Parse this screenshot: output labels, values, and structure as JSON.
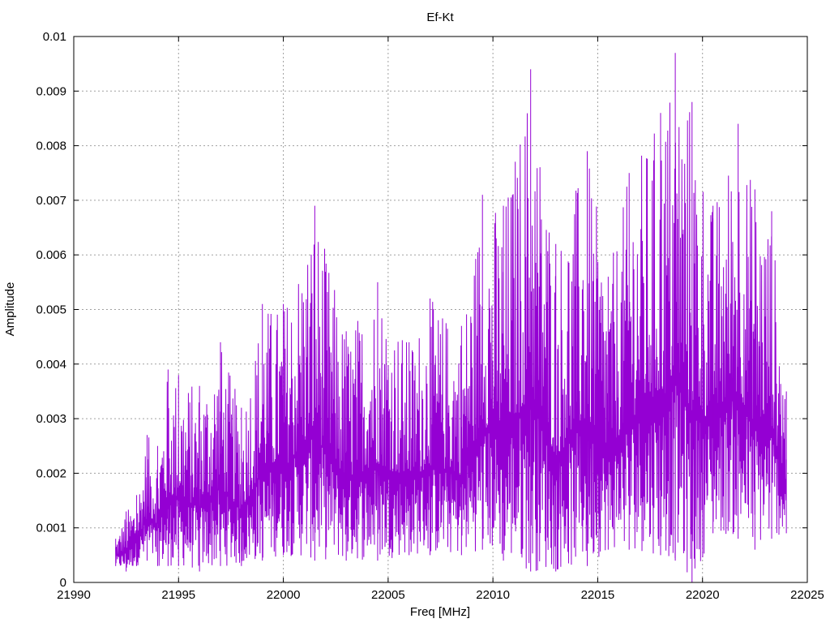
{
  "chart_data": {
    "type": "line",
    "title": "Ef-Kt",
    "xlabel": "Freq [MHz]",
    "ylabel": "Amplitude",
    "xlim": [
      21990,
      22025
    ],
    "ylim": [
      0,
      0.01
    ],
    "xticks": [
      "21990",
      "21995",
      "22000",
      "22005",
      "22010",
      "22015",
      "22020",
      "22025"
    ],
    "yticks": [
      "0",
      "0.001",
      "0.002",
      "0.003",
      "0.004",
      "0.005",
      "0.006",
      "0.007",
      "0.008",
      "0.009",
      "0.01"
    ],
    "grid": true,
    "legend": "none",
    "series": [
      {
        "color": "#9400d3",
        "x_start": 21992.0,
        "x_end": 22024.0,
        "envelope": [
          {
            "x": 21992.0,
            "low": 0.0003,
            "high": 0.0008
          },
          {
            "x": 21992.5,
            "low": 0.0002,
            "high": 0.0013
          },
          {
            "x": 21993.0,
            "low": 0.0003,
            "high": 0.0016
          },
          {
            "x": 21993.5,
            "low": 0.0004,
            "high": 0.0027
          },
          {
            "x": 21994.0,
            "low": 0.0003,
            "high": 0.0025
          },
          {
            "x": 21994.5,
            "low": 0.0003,
            "high": 0.0039
          },
          {
            "x": 21995.0,
            "low": 0.0003,
            "high": 0.0038
          },
          {
            "x": 21996.0,
            "low": 0.0002,
            "high": 0.0036
          },
          {
            "x": 21997.0,
            "low": 0.0003,
            "high": 0.0044
          },
          {
            "x": 21998.0,
            "low": 0.0003,
            "high": 0.0032
          },
          {
            "x": 21999.0,
            "low": 0.0004,
            "high": 0.0051
          },
          {
            "x": 22000.0,
            "low": 0.0005,
            "high": 0.0051
          },
          {
            "x": 22001.5,
            "low": 0.0004,
            "high": 0.0069
          },
          {
            "x": 22003.0,
            "low": 0.0004,
            "high": 0.0046
          },
          {
            "x": 22004.5,
            "low": 0.0004,
            "high": 0.0055
          },
          {
            "x": 22006.0,
            "low": 0.0005,
            "high": 0.0044
          },
          {
            "x": 22007.0,
            "low": 0.0005,
            "high": 0.0052
          },
          {
            "x": 22008.5,
            "low": 0.0005,
            "high": 0.0047
          },
          {
            "x": 22009.5,
            "low": 0.0006,
            "high": 0.0071
          },
          {
            "x": 22010.5,
            "low": 0.0004,
            "high": 0.0069
          },
          {
            "x": 22011.8,
            "low": 0.0002,
            "high": 0.0094
          },
          {
            "x": 22013.0,
            "low": 0.0002,
            "high": 0.0062
          },
          {
            "x": 22014.5,
            "low": 0.0003,
            "high": 0.0079
          },
          {
            "x": 22015.5,
            "low": 0.0006,
            "high": 0.0056
          },
          {
            "x": 22016.5,
            "low": 0.0006,
            "high": 0.0075
          },
          {
            "x": 22018.0,
            "low": 0.0005,
            "high": 0.0086
          },
          {
            "x": 22018.7,
            "low": 0.0004,
            "high": 0.0097
          },
          {
            "x": 22019.5,
            "low": 0.0,
            "high": 0.0088
          },
          {
            "x": 22020.5,
            "low": 0.0009,
            "high": 0.0069
          },
          {
            "x": 22021.7,
            "low": 0.0008,
            "high": 0.0084
          },
          {
            "x": 22022.5,
            "low": 0.0006,
            "high": 0.0072
          },
          {
            "x": 22023.3,
            "low": 0.0008,
            "high": 0.0068
          },
          {
            "x": 22024.0,
            "low": 0.0009,
            "high": 0.0035
          }
        ]
      }
    ]
  }
}
